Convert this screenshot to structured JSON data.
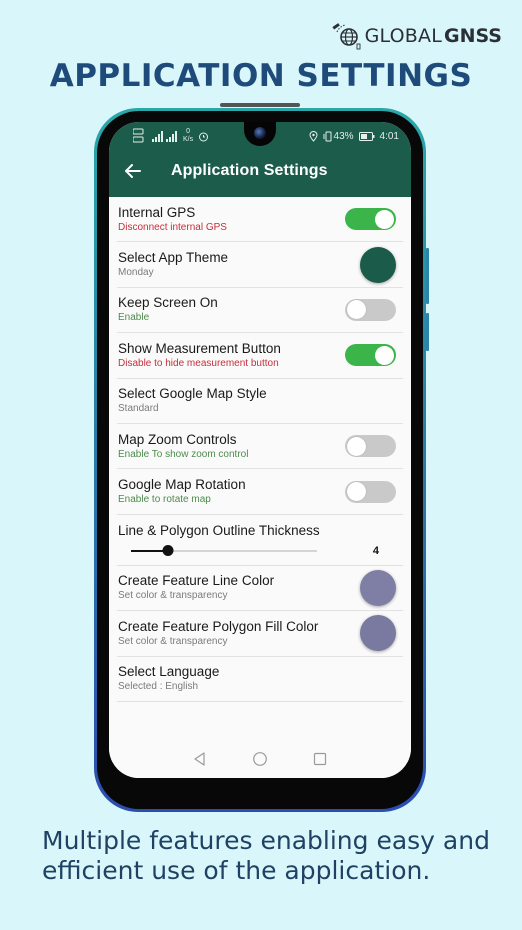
{
  "brand": {
    "name_light": "GLOBAL",
    "name_bold": "GNSS",
    "icon": "satellite-globe-icon"
  },
  "headline": "APPLICATION SETTINGS",
  "caption": "Multiple features enabling easy and efficient use of the application.",
  "colors": {
    "background": "#d9f7fa",
    "headline": "#1f4b7a",
    "appbar": "#1c5c4b",
    "switch_on": "#3bb54a",
    "switch_off": "#c9c9c9",
    "subtitle_red": "#c62e3c",
    "subtitle_green": "#4d8a4d"
  },
  "statusbar": {
    "left_icons": [
      "sim1-icon",
      "sim2-icon",
      "signal-icon",
      "signal-4g-icon",
      "network-speed-icon",
      "alarm-icon"
    ],
    "network_speed": "0",
    "network_speed_unit": "K/s",
    "right_icons": [
      "location-icon",
      "vibrate-icon",
      "battery-icon"
    ],
    "battery": "43%",
    "time": "4:01"
  },
  "app": {
    "title": "Application Settings",
    "back_icon": "arrow-left-icon"
  },
  "settings": [
    {
      "title": "Internal GPS",
      "subtitle": "Disconnect internal GPS",
      "subtitle_color": "red",
      "control": "switch",
      "value": true
    },
    {
      "title": "Select App Theme",
      "subtitle": "Monday",
      "subtitle_color": "gray",
      "control": "swatch",
      "color": "#1b5b4a"
    },
    {
      "title": "Keep Screen On",
      "subtitle": "Enable",
      "subtitle_color": "green",
      "control": "switch",
      "value": false
    },
    {
      "title": "Show Measurement Button",
      "subtitle": "Disable to hide measurement button",
      "subtitle_color": "red",
      "control": "switch",
      "value": true
    },
    {
      "title": "Select Google Map Style",
      "subtitle": "Standard",
      "subtitle_color": "gray",
      "control": "none"
    },
    {
      "title": "Map Zoom Controls",
      "subtitle": "Enable To show zoom control",
      "subtitle_color": "green",
      "control": "switch",
      "value": false
    },
    {
      "title": "Google Map Rotation",
      "subtitle": "Enable to rotate map",
      "subtitle_color": "green",
      "control": "switch",
      "value": false
    }
  ],
  "thickness": {
    "title": "Line & Polygon Outline Thickness",
    "value": "4",
    "slider_fraction": 0.2
  },
  "settings_after": [
    {
      "title": "Create Feature Line Color",
      "subtitle": "Set color & transparency",
      "subtitle_color": "gray",
      "control": "swatch",
      "color": "#7f7fa6"
    },
    {
      "title": "Create Feature Polygon Fill Color",
      "subtitle": "Set color & transparency",
      "subtitle_color": "gray",
      "control": "swatch",
      "color": "#7a7aa0"
    },
    {
      "title": "Select Language",
      "subtitle": "Selected : English",
      "subtitle_color": "gray",
      "control": "none"
    }
  ],
  "navbar": {
    "back": "nav-back-icon",
    "home": "nav-home-icon",
    "recents": "nav-recents-icon"
  }
}
